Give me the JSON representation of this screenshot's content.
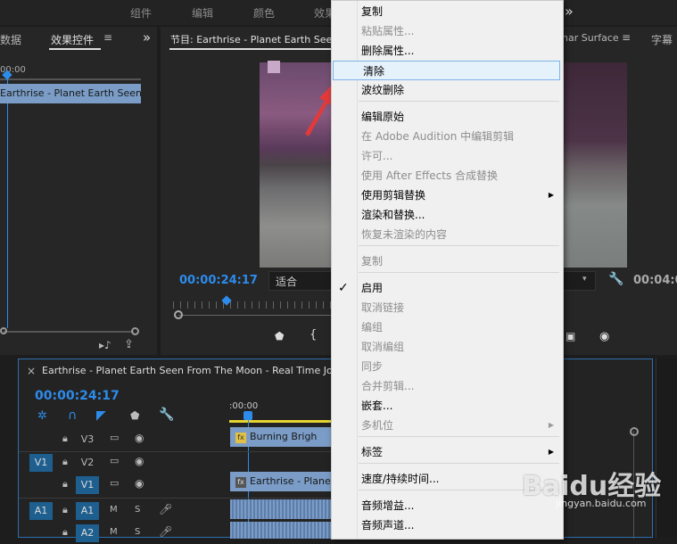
{
  "workspace_tabs": [
    "组件",
    "编辑",
    "颜色",
    "效果"
  ],
  "more_glyph": "»",
  "left_panel": {
    "tab_cut": "数据",
    "tab_active": "效果控件",
    "menu_glyph": "≡",
    "timecode_cut": "00:00",
    "clip_label": "Earthrise - Planet Earth Seen Fr"
  },
  "program_monitor": {
    "title": "节目: Earthrise - Planet Earth Seen",
    "timecode": "00:00:24:17",
    "fit_label": "适合"
  },
  "right_monitor": {
    "tab_cut": "nar Surface",
    "tab_cut2": "字幕",
    "timecode_cut": "00:04:0"
  },
  "timeline": {
    "close": "×",
    "title": "Earthrise - Planet Earth Seen From The Moon - Real Time Journe",
    "timecode": "00:00:24:17",
    "ruler_label": ":00:00",
    "tracks": [
      {
        "source": "",
        "name": "V3"
      },
      {
        "source": "V1",
        "name": "V2"
      },
      {
        "source": "",
        "name": "V1"
      },
      {
        "source": "A1",
        "name": "A1",
        "m": "M",
        "s": "S"
      },
      {
        "source": "",
        "name": "A2",
        "m": "M",
        "s": "S"
      }
    ],
    "clips": [
      {
        "fx": "fx",
        "label": "Burning Brigh"
      },
      {
        "fx": "fx",
        "label": "Earthrise - Planet"
      }
    ]
  },
  "context_menu": {
    "items": [
      {
        "label": "复制",
        "enabled": true
      },
      {
        "label": "粘贴属性...",
        "enabled": false
      },
      {
        "label": "删除属性...",
        "enabled": true
      },
      {
        "label": "清除",
        "enabled": true,
        "highlighted": true
      },
      {
        "label": "波纹删除",
        "enabled": true
      },
      {
        "label": "编辑原始",
        "enabled": true
      },
      {
        "label": "在 Adobe Audition 中编辑剪辑",
        "enabled": false
      },
      {
        "label": "许可...",
        "enabled": false
      },
      {
        "label": "使用 After Effects 合成替换",
        "enabled": false
      },
      {
        "label": "使用剪辑替换",
        "enabled": true,
        "submenu": true
      },
      {
        "label": "渲染和替换...",
        "enabled": true
      },
      {
        "label": "恢复未渲染的内容",
        "enabled": false
      },
      {
        "label": "复制",
        "enabled": false
      },
      {
        "label": "启用",
        "enabled": true,
        "checked": true
      },
      {
        "label": "取消链接",
        "enabled": false
      },
      {
        "label": "编组",
        "enabled": false
      },
      {
        "label": "取消编组",
        "enabled": false
      },
      {
        "label": "同步",
        "enabled": false
      },
      {
        "label": "合并剪辑...",
        "enabled": false
      },
      {
        "label": "嵌套...",
        "enabled": true
      },
      {
        "label": "多机位",
        "enabled": false,
        "submenu": true
      },
      {
        "label": "标签",
        "enabled": true,
        "submenu": true
      },
      {
        "label": "速度/持续时间...",
        "enabled": true
      },
      {
        "label": "音频增益...",
        "enabled": true
      },
      {
        "label": "音频声道...",
        "enabled": true
      }
    ],
    "check_glyph": "✓",
    "arrow_glyph": "▶"
  },
  "watermark": {
    "brand": "Baidu经验",
    "url": "jingyan.baidu.com"
  },
  "colors": {
    "accent_blue": "#2d8ceb",
    "highlight_bg": "#e5f1fb",
    "highlight_border": "#7eb4ea",
    "annotation_arrow": "#e23a3a"
  }
}
